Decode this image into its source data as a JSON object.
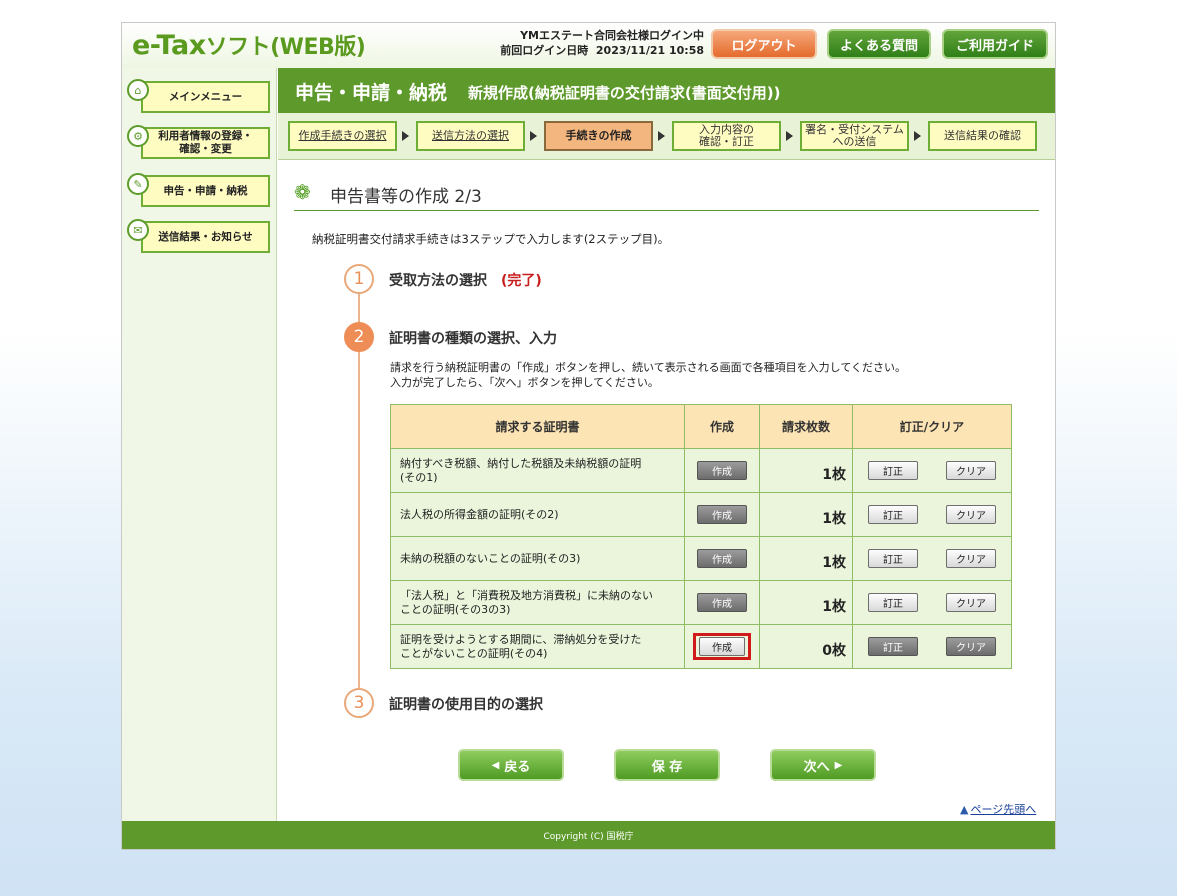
{
  "header": {
    "logo_main": "e-Tax",
    "logo_sub": "ソフト(WEB版)",
    "user_line": "YMエステート合同会社様ログイン中",
    "last_login_label": "前回ログイン日時",
    "last_login_value": "2023/11/21 10:58",
    "logout_label": "ログアウト",
    "faq_label": "よくある質問",
    "guide_label": "ご利用ガイド"
  },
  "sidebar": {
    "items": [
      {
        "label": "メインメニュー",
        "icon": "home-icon"
      },
      {
        "label": "利用者情報の登録・確認・変更",
        "line1": "利用者情報の登録・",
        "line2": "確認・変更",
        "icon": "settings-icon"
      },
      {
        "label": "申告・申請・納税",
        "icon": "document-icon"
      },
      {
        "label": "送信結果・お知らせ",
        "icon": "mail-icon"
      }
    ]
  },
  "titlebar": {
    "main": "申告・申請・納税",
    "sub": "新規作成(納税証明書の交付請求(書面交付用))"
  },
  "steps": [
    {
      "label": "作成手続きの選択",
      "state": "link"
    },
    {
      "label": "送信方法の選択",
      "state": "link"
    },
    {
      "label": "手続きの作成",
      "state": "current"
    },
    {
      "line1": "入力内容の",
      "line2": "確認・訂正",
      "state": "future"
    },
    {
      "line1": "署名・受付システム",
      "line2": "への送信",
      "state": "future"
    },
    {
      "label": "送信結果の確認",
      "state": "future"
    }
  ],
  "content": {
    "title": "申告書等の作成 2/3",
    "intro": "納税証明書交付請求手続きは3ステップで入力します(2ステップ目)。",
    "step1": {
      "num": "1",
      "title": "受取方法の選択",
      "status": "(完了)"
    },
    "step2": {
      "num": "2",
      "title": "証明書の種類の選択、入力",
      "desc1": "請求を行う納税証明書の「作成」ボタンを押し、続いて表示される画面で各種項目を入力してください。",
      "desc2": "入力が完了したら、「次へ」ボタンを押してください。"
    },
    "step3": {
      "num": "3",
      "title": "証明書の使用目的の選択"
    }
  },
  "table": {
    "headers": [
      "請求する証明書",
      "作成",
      "請求枚数",
      "訂正/クリア"
    ],
    "rows": [
      {
        "line1": "納付すべき税額、納付した税額及未納税額の証明",
        "line2": "(その1)",
        "create": "作成",
        "count": "1枚",
        "fix": "訂正",
        "clear": "クリア"
      },
      {
        "line1": "法人税の所得金額の証明(その2)",
        "line2": "",
        "create": "作成",
        "count": "1枚",
        "fix": "訂正",
        "clear": "クリア"
      },
      {
        "line1": "未納の税額のないことの証明(その3)",
        "line2": "",
        "create": "作成",
        "count": "1枚",
        "fix": "訂正",
        "clear": "クリア"
      },
      {
        "line1": "「法人税」と「消費税及地方消費税」に未納のない",
        "line2": "ことの証明(その3の3)",
        "create": "作成",
        "count": "1枚",
        "fix": "訂正",
        "clear": "クリア"
      },
      {
        "line1": "証明を受けようとする期間に、滞納処分を受けた",
        "line2": "ことがないことの証明(その4)",
        "create": "作成",
        "count": "0枚",
        "fix": "訂正",
        "clear": "クリア"
      }
    ]
  },
  "buttons": {
    "back": "戻る",
    "save": "保 存",
    "next": "次へ"
  },
  "page_top": "ページ先頭へ",
  "footer": "Copyright (C) 国税庁"
}
